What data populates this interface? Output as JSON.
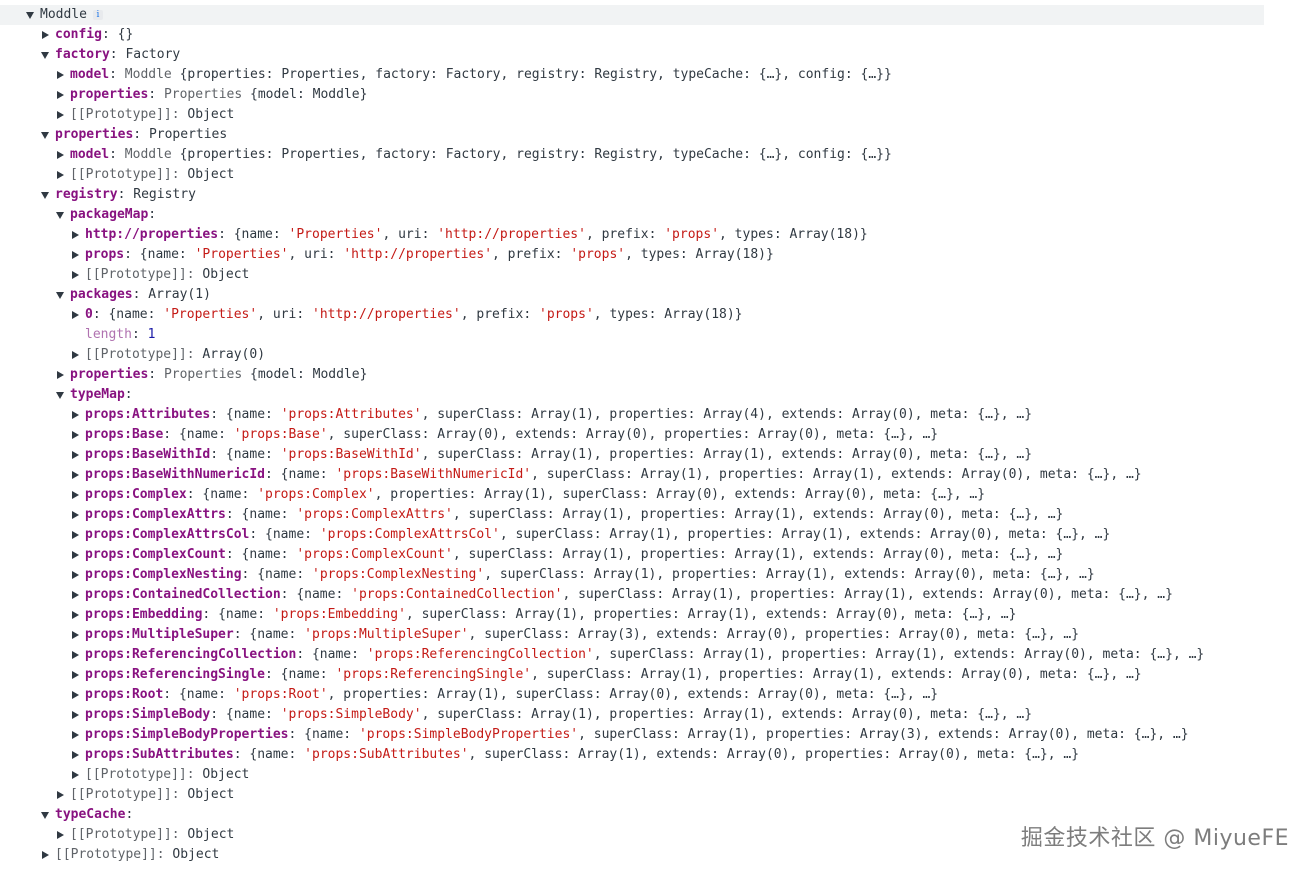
{
  "watermark": "掘金技术社区 @ MiyueFE",
  "rows": [
    {
      "d": 0,
      "exp": "down",
      "top": true,
      "info": true,
      "label": "Moddle",
      "labelPlain": true,
      "value": []
    },
    {
      "d": 1,
      "exp": "right",
      "label": "config",
      "value": [
        [
          "v",
          "{}"
        ]
      ]
    },
    {
      "d": 1,
      "exp": "down",
      "label": "factory",
      "value": [
        [
          "v",
          "Factory"
        ]
      ]
    },
    {
      "d": 2,
      "exp": "right",
      "label": "model",
      "value": [
        [
          "c",
          "Moddle "
        ],
        [
          "v",
          "{properties: Properties, factory: Factory, registry: Registry, typeCache: {…}, config: {…}}"
        ]
      ]
    },
    {
      "d": 2,
      "exp": "right",
      "label": "properties",
      "value": [
        [
          "c",
          "Properties "
        ],
        [
          "v",
          "{model: Moddle}"
        ]
      ]
    },
    {
      "d": 2,
      "exp": "right",
      "proto": true,
      "label": "[[Prototype]]",
      "value": [
        [
          "v",
          "Object"
        ]
      ]
    },
    {
      "d": 1,
      "exp": "down",
      "label": "properties",
      "value": [
        [
          "v",
          "Properties"
        ]
      ]
    },
    {
      "d": 2,
      "exp": "right",
      "label": "model",
      "value": [
        [
          "c",
          "Moddle "
        ],
        [
          "v",
          "{properties: Properties, factory: Factory, registry: Registry, typeCache: {…}, config: {…}}"
        ]
      ]
    },
    {
      "d": 2,
      "exp": "right",
      "proto": true,
      "label": "[[Prototype]]",
      "value": [
        [
          "v",
          "Object"
        ]
      ]
    },
    {
      "d": 1,
      "exp": "down",
      "label": "registry",
      "value": [
        [
          "v",
          "Registry"
        ]
      ]
    },
    {
      "d": 2,
      "exp": "down",
      "label": "packageMap",
      "value": []
    },
    {
      "d": 3,
      "exp": "right",
      "label": "http://properties",
      "value": [
        [
          "v",
          "{name: "
        ],
        [
          "s",
          "'Properties'"
        ],
        [
          "v",
          ", uri: "
        ],
        [
          "s",
          "'http://properties'"
        ],
        [
          "v",
          ", prefix: "
        ],
        [
          "s",
          "'props'"
        ],
        [
          "v",
          ", types: Array(18)}"
        ]
      ]
    },
    {
      "d": 3,
      "exp": "right",
      "label": "props",
      "value": [
        [
          "v",
          "{name: "
        ],
        [
          "s",
          "'Properties'"
        ],
        [
          "v",
          ", uri: "
        ],
        [
          "s",
          "'http://properties'"
        ],
        [
          "v",
          ", prefix: "
        ],
        [
          "s",
          "'props'"
        ],
        [
          "v",
          ", types: Array(18)}"
        ]
      ]
    },
    {
      "d": 3,
      "exp": "right",
      "proto": true,
      "label": "[[Prototype]]",
      "value": [
        [
          "v",
          "Object"
        ]
      ]
    },
    {
      "d": 2,
      "exp": "down",
      "label": "packages",
      "value": [
        [
          "v",
          "Array(1)"
        ]
      ]
    },
    {
      "d": 3,
      "exp": "right",
      "label": "0",
      "value": [
        [
          "v",
          "{name: "
        ],
        [
          "s",
          "'Properties'"
        ],
        [
          "v",
          ", uri: "
        ],
        [
          "s",
          "'http://properties'"
        ],
        [
          "v",
          ", prefix: "
        ],
        [
          "s",
          "'props'"
        ],
        [
          "v",
          ", types: Array(18)}"
        ]
      ]
    },
    {
      "d": 3,
      "exp": "none",
      "dim": true,
      "label": "length",
      "value": [
        [
          "n",
          "1"
        ]
      ]
    },
    {
      "d": 3,
      "exp": "right",
      "proto": true,
      "label": "[[Prototype]]",
      "value": [
        [
          "v",
          "Array(0)"
        ]
      ]
    },
    {
      "d": 2,
      "exp": "right",
      "label": "properties",
      "value": [
        [
          "c",
          "Properties "
        ],
        [
          "v",
          "{model: Moddle}"
        ]
      ]
    },
    {
      "d": 2,
      "exp": "down",
      "label": "typeMap",
      "value": []
    },
    {
      "d": 3,
      "exp": "right",
      "label": "props:Attributes",
      "value": [
        [
          "v",
          "{name: "
        ],
        [
          "s",
          "'props:Attributes'"
        ],
        [
          "v",
          ", superClass: Array(1), properties: Array(4), extends: Array(0), meta: {…}, …}"
        ]
      ]
    },
    {
      "d": 3,
      "exp": "right",
      "label": "props:Base",
      "value": [
        [
          "v",
          "{name: "
        ],
        [
          "s",
          "'props:Base'"
        ],
        [
          "v",
          ", superClass: Array(0), extends: Array(0), properties: Array(0), meta: {…}, …}"
        ]
      ]
    },
    {
      "d": 3,
      "exp": "right",
      "label": "props:BaseWithId",
      "value": [
        [
          "v",
          "{name: "
        ],
        [
          "s",
          "'props:BaseWithId'"
        ],
        [
          "v",
          ", superClass: Array(1), properties: Array(1), extends: Array(0), meta: {…}, …}"
        ]
      ]
    },
    {
      "d": 3,
      "exp": "right",
      "label": "props:BaseWithNumericId",
      "value": [
        [
          "v",
          "{name: "
        ],
        [
          "s",
          "'props:BaseWithNumericId'"
        ],
        [
          "v",
          ", superClass: Array(1), properties: Array(1), extends: Array(0), meta: {…}, …}"
        ]
      ]
    },
    {
      "d": 3,
      "exp": "right",
      "label": "props:Complex",
      "value": [
        [
          "v",
          "{name: "
        ],
        [
          "s",
          "'props:Complex'"
        ],
        [
          "v",
          ", properties: Array(1), superClass: Array(0), extends: Array(0), meta: {…}, …}"
        ]
      ]
    },
    {
      "d": 3,
      "exp": "right",
      "label": "props:ComplexAttrs",
      "value": [
        [
          "v",
          "{name: "
        ],
        [
          "s",
          "'props:ComplexAttrs'"
        ],
        [
          "v",
          ", superClass: Array(1), properties: Array(1), extends: Array(0), meta: {…}, …}"
        ]
      ]
    },
    {
      "d": 3,
      "exp": "right",
      "label": "props:ComplexAttrsCol",
      "value": [
        [
          "v",
          "{name: "
        ],
        [
          "s",
          "'props:ComplexAttrsCol'"
        ],
        [
          "v",
          ", superClass: Array(1), properties: Array(1), extends: Array(0), meta: {…}, …}"
        ]
      ]
    },
    {
      "d": 3,
      "exp": "right",
      "label": "props:ComplexCount",
      "value": [
        [
          "v",
          "{name: "
        ],
        [
          "s",
          "'props:ComplexCount'"
        ],
        [
          "v",
          ", superClass: Array(1), properties: Array(1), extends: Array(0), meta: {…}, …}"
        ]
      ]
    },
    {
      "d": 3,
      "exp": "right",
      "label": "props:ComplexNesting",
      "value": [
        [
          "v",
          "{name: "
        ],
        [
          "s",
          "'props:ComplexNesting'"
        ],
        [
          "v",
          ", superClass: Array(1), properties: Array(1), extends: Array(0), meta: {…}, …}"
        ]
      ]
    },
    {
      "d": 3,
      "exp": "right",
      "label": "props:ContainedCollection",
      "value": [
        [
          "v",
          "{name: "
        ],
        [
          "s",
          "'props:ContainedCollection'"
        ],
        [
          "v",
          ", superClass: Array(1), properties: Array(1), extends: Array(0), meta: {…}, …}"
        ]
      ]
    },
    {
      "d": 3,
      "exp": "right",
      "label": "props:Embedding",
      "value": [
        [
          "v",
          "{name: "
        ],
        [
          "s",
          "'props:Embedding'"
        ],
        [
          "v",
          ", superClass: Array(1), properties: Array(1), extends: Array(0), meta: {…}, …}"
        ]
      ]
    },
    {
      "d": 3,
      "exp": "right",
      "label": "props:MultipleSuper",
      "value": [
        [
          "v",
          "{name: "
        ],
        [
          "s",
          "'props:MultipleSuper'"
        ],
        [
          "v",
          ", superClass: Array(3), extends: Array(0), properties: Array(0), meta: {…}, …}"
        ]
      ]
    },
    {
      "d": 3,
      "exp": "right",
      "label": "props:ReferencingCollection",
      "value": [
        [
          "v",
          "{name: "
        ],
        [
          "s",
          "'props:ReferencingCollection'"
        ],
        [
          "v",
          ", superClass: Array(1), properties: Array(1), extends: Array(0), meta: {…}, …}"
        ]
      ]
    },
    {
      "d": 3,
      "exp": "right",
      "label": "props:ReferencingSingle",
      "value": [
        [
          "v",
          "{name: "
        ],
        [
          "s",
          "'props:ReferencingSingle'"
        ],
        [
          "v",
          ", superClass: Array(1), properties: Array(1), extends: Array(0), meta: {…}, …}"
        ]
      ]
    },
    {
      "d": 3,
      "exp": "right",
      "label": "props:Root",
      "value": [
        [
          "v",
          "{name: "
        ],
        [
          "s",
          "'props:Root'"
        ],
        [
          "v",
          ", properties: Array(1), superClass: Array(0), extends: Array(0), meta: {…}, …}"
        ]
      ]
    },
    {
      "d": 3,
      "exp": "right",
      "label": "props:SimpleBody",
      "value": [
        [
          "v",
          "{name: "
        ],
        [
          "s",
          "'props:SimpleBody'"
        ],
        [
          "v",
          ", superClass: Array(1), properties: Array(1), extends: Array(0), meta: {…}, …}"
        ]
      ]
    },
    {
      "d": 3,
      "exp": "right",
      "label": "props:SimpleBodyProperties",
      "value": [
        [
          "v",
          "{name: "
        ],
        [
          "s",
          "'props:SimpleBodyProperties'"
        ],
        [
          "v",
          ", superClass: Array(1), properties: Array(3), extends: Array(0), meta: {…}, …}"
        ]
      ]
    },
    {
      "d": 3,
      "exp": "right",
      "label": "props:SubAttributes",
      "value": [
        [
          "v",
          "{name: "
        ],
        [
          "s",
          "'props:SubAttributes'"
        ],
        [
          "v",
          ", superClass: Array(1), extends: Array(0), properties: Array(0), meta: {…}, …}"
        ]
      ]
    },
    {
      "d": 3,
      "exp": "right",
      "proto": true,
      "label": "[[Prototype]]",
      "value": [
        [
          "v",
          "Object"
        ]
      ]
    },
    {
      "d": 2,
      "exp": "right",
      "proto": true,
      "label": "[[Prototype]]",
      "value": [
        [
          "v",
          "Object"
        ]
      ]
    },
    {
      "d": 1,
      "exp": "down",
      "label": "typeCache",
      "value": []
    },
    {
      "d": 2,
      "exp": "right",
      "proto": true,
      "label": "[[Prototype]]",
      "value": [
        [
          "v",
          "Object"
        ]
      ]
    },
    {
      "d": 1,
      "exp": "right",
      "proto": true,
      "label": "[[Prototype]]",
      "value": [
        [
          "v",
          "Object"
        ]
      ]
    }
  ],
  "colors": {
    "key": "#881280",
    "string": "#c41a16",
    "number": "#1a1aa6",
    "text": "#303942",
    "muted": "#5f6368"
  }
}
